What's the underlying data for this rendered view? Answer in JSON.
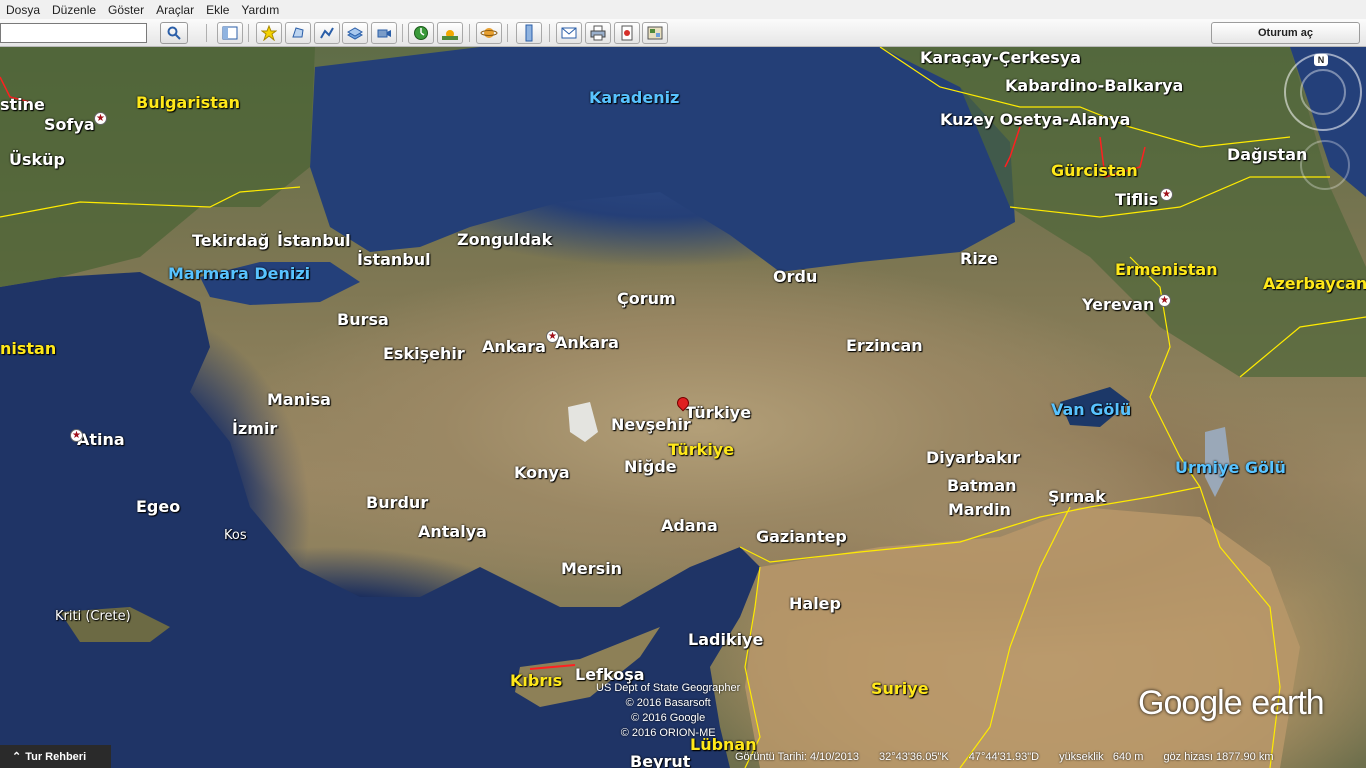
{
  "menu": [
    "Dosya",
    "Düzenle",
    "Göster",
    "Araçlar",
    "Ekle",
    "Yardım"
  ],
  "search": {
    "value": "",
    "icon": "search-icon"
  },
  "toolbar": {
    "signin_label": "Oturum aç",
    "icons": [
      "sidebar-icon",
      "placemark-icon",
      "polygon-icon",
      "path-icon",
      "overlay-icon",
      "tour-icon",
      "history-icon",
      "sunlight-icon",
      "planet-icon",
      "ruler-icon",
      "email-icon",
      "print-icon",
      "save-image-icon",
      "maps-icon"
    ]
  },
  "map": {
    "labels": [
      {
        "text": "Karadeniz",
        "kind": "water"
      },
      {
        "text": "Marmara Denizi",
        "kind": "water"
      },
      {
        "text": "Van Gölü",
        "kind": "water"
      },
      {
        "text": "Urmiye Gölü",
        "kind": "water"
      },
      {
        "text": "Bulgaristan",
        "kind": "country"
      },
      {
        "text": "Gürcistan",
        "kind": "country"
      },
      {
        "text": "Ermenistan",
        "kind": "country"
      },
      {
        "text": "Azerbaycan",
        "kind": "country"
      },
      {
        "text": "Türkiye",
        "kind": "country"
      },
      {
        "text": "Suriye",
        "kind": "country"
      },
      {
        "text": "Kıbrıs",
        "kind": "country"
      },
      {
        "text": "Lübnan",
        "kind": "country"
      },
      {
        "text": "nistan",
        "kind": "country"
      },
      {
        "text": "Karaçay-Çerkesya",
        "kind": "city"
      },
      {
        "text": "Kabardino-Balkarya",
        "kind": "city"
      },
      {
        "text": "Kuzey Osetya-Alanya",
        "kind": "city"
      },
      {
        "text": "Dağıstan",
        "kind": "city"
      },
      {
        "text": "Tiflis",
        "kind": "city"
      },
      {
        "text": "stine",
        "kind": "city"
      },
      {
        "text": "Sofya",
        "kind": "city"
      },
      {
        "text": "Üsküp",
        "kind": "city"
      },
      {
        "text": "Tekirdağ",
        "kind": "city"
      },
      {
        "text": "İstanbul",
        "kind": "city"
      },
      {
        "text": "İstanbul",
        "kind": "city"
      },
      {
        "text": "Zonguldak",
        "kind": "city"
      },
      {
        "text": "Ordu",
        "kind": "city"
      },
      {
        "text": "Rize",
        "kind": "city"
      },
      {
        "text": "Yerevan",
        "kind": "city"
      },
      {
        "text": "Bursa",
        "kind": "city"
      },
      {
        "text": "Çorum",
        "kind": "city"
      },
      {
        "text": "Eskişehir",
        "kind": "city"
      },
      {
        "text": "Ankara",
        "kind": "city"
      },
      {
        "text": "Ankara",
        "kind": "city"
      },
      {
        "text": "Erzincan",
        "kind": "city"
      },
      {
        "text": "Manisa",
        "kind": "city"
      },
      {
        "text": "Türkiye",
        "kind": "city"
      },
      {
        "text": "Atina",
        "kind": "city"
      },
      {
        "text": "İzmir",
        "kind": "city"
      },
      {
        "text": "Nevşehir",
        "kind": "city"
      },
      {
        "text": "Niğde",
        "kind": "city"
      },
      {
        "text": "Konya",
        "kind": "city"
      },
      {
        "text": "Diyarbakır",
        "kind": "city"
      },
      {
        "text": "Batman",
        "kind": "city"
      },
      {
        "text": "Şırnak",
        "kind": "city"
      },
      {
        "text": "Mardin",
        "kind": "city"
      },
      {
        "text": "Egeo",
        "kind": "city"
      },
      {
        "text": "Burdur",
        "kind": "city"
      },
      {
        "text": "Kos",
        "kind": "small"
      },
      {
        "text": "Antalya",
        "kind": "city"
      },
      {
        "text": "Adana",
        "kind": "city"
      },
      {
        "text": "Gaziantep",
        "kind": "city"
      },
      {
        "text": "Mersin",
        "kind": "city"
      },
      {
        "text": "Halep",
        "kind": "city"
      },
      {
        "text": "Kriti (Crete)",
        "kind": "small"
      },
      {
        "text": "Ladikiye",
        "kind": "city"
      },
      {
        "text": "Lefkoşa",
        "kind": "city"
      },
      {
        "text": "Beyrut",
        "kind": "city"
      }
    ]
  },
  "copyright": [
    "US Dept of State Geographer",
    "© 2016 Basarsoft",
    "© 2016 Google",
    "© 2016 ORION-ME"
  ],
  "brand": {
    "google": "Google",
    "earth": "earth"
  },
  "compass_n": "N",
  "tour_guide": "Tur Rehberi",
  "status": {
    "imagery_date": "Görüntü Tarihi: 4/10/2013",
    "lat": "32°43'36.05\"K",
    "lon": "47°44'31.93\"D",
    "elevation": "yükseklik   640 m",
    "eye_alt": "göz hizası 1877.90 km"
  }
}
